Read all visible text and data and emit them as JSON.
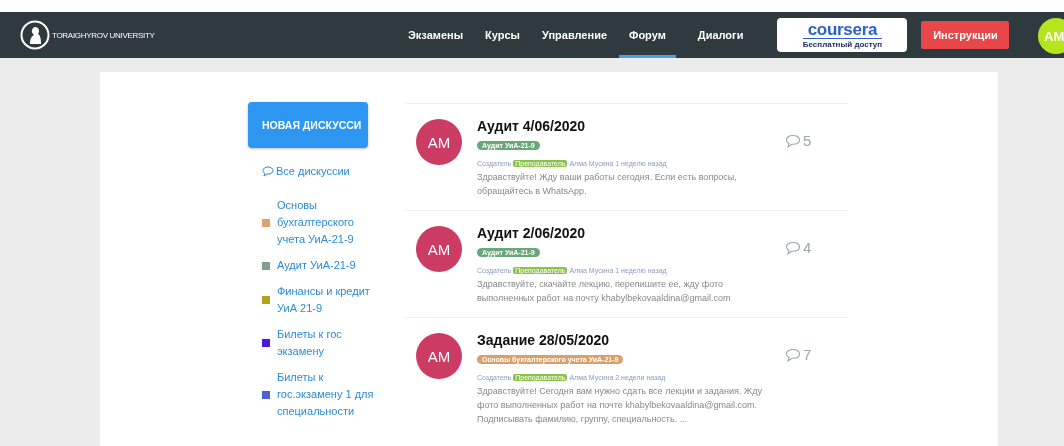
{
  "header": {
    "logo_text": "TORAIGHYROV UNIVERSITY",
    "nav": [
      {
        "label": "Экзамены",
        "selected": false
      },
      {
        "label": "Курсы",
        "selected": false
      },
      {
        "label": "Управление",
        "selected": false
      },
      {
        "label": "Форум",
        "selected": true
      },
      {
        "label": "Диалоги",
        "selected": false
      }
    ],
    "coursera": {
      "brand": "coursera",
      "caption": "Бесплатный доступ"
    },
    "instructions_button": "Инструкции",
    "avatar": "AM"
  },
  "sidebar": {
    "new_discussion_button": "НОВАЯ ДИСКУССИ",
    "all_discussions": "Все дискуссии",
    "categories": [
      {
        "label": "Основы бухгалтерского учета УиА-21-9",
        "color": "#e0a070"
      },
      {
        "label": "Аудит УиА-21-9",
        "color": "#7fa08a"
      },
      {
        "label": "Финансы и кредит УиА 21-9",
        "color": "#b5a020"
      },
      {
        "label": "Билеты к гос экзамену",
        "color": "#4a18e0"
      },
      {
        "label": "Билеты к гос.экзамену 1 для специальности",
        "color": "#4a5fd8"
      }
    ]
  },
  "posts": [
    {
      "avatar": "AM",
      "title": "Аудит 4/06/2020",
      "tag": "Аудит УиА-21-9",
      "color": "#6aa879",
      "creator_label": "Создатель",
      "role": "Преподаватель",
      "author": "Алма Мусина 1 неделю назад",
      "excerpt": "Здравствуйте! Жду ваши работы сегодня. Если есть вопросы, обращайтесь в WhatsApp.",
      "comments": "5"
    },
    {
      "avatar": "AM",
      "title": "Аудит 2/06/2020",
      "tag": "Аудит УиА-21-9",
      "color": "#6aa879",
      "creator_label": "Создатель",
      "role": "Преподаватель",
      "author": "Алма Мусина 1 неделю назад",
      "excerpt": "Здравствуйте, скачайте лекцию, перепишите ее, жду фото выполненных работ на почту khabylbekovaaldina@gmail.com",
      "comments": "4"
    },
    {
      "avatar": "AM",
      "title": "Задание 28/05/2020",
      "tag": "Основы бухгалтерского учета УиА-21-9",
      "color": "#d9a06a",
      "creator_label": "Создатель",
      "role": "Преподаватель",
      "author": "Алма Мусина 2 недели назад",
      "excerpt": "Здравствуйте! Сегодня вам нужно сдать все лекции и задания. Жду фото выполненных работ на почте khabylbekovaaldina@gmail.com. Подписывать фамилию, группу, специальность. ...",
      "comments": "7"
    }
  ]
}
